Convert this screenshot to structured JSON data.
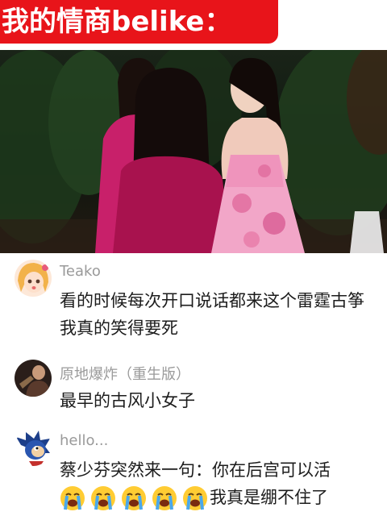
{
  "overlay": {
    "title": "我的情商belike："
  },
  "comments": [
    {
      "username": "Teako",
      "text": "看的时候每次开口说话都来这个雷霆古筝 我真的笑得要死",
      "avatar_icon": "anime-girl-avatar-icon"
    },
    {
      "username": "原地爆炸（重生版）",
      "text": "最早的古风小女子",
      "avatar_icon": "dark-figure-avatar-icon"
    },
    {
      "username": "hello...",
      "text_line1": "蔡少芬突然来一句：你在后宫可以活",
      "text_line2": "我真是绷不住了",
      "emoji_name": "loudly-crying-face-icon",
      "emoji_count": 5,
      "avatar_icon": "blue-hedgehog-avatar-icon"
    }
  ],
  "colors": {
    "title_bg": "#e8141a",
    "title_text": "#ffffff",
    "username": "#9a9a9a",
    "comment_text": "#1c1c1c"
  }
}
